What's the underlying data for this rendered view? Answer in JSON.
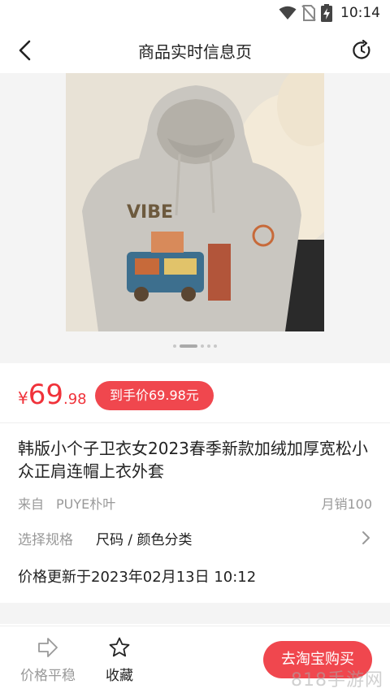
{
  "status_bar": {
    "time": "10:14",
    "icons": [
      "wifi-icon",
      "no-sim-icon",
      "battery-charging-icon"
    ]
  },
  "nav": {
    "title": "商品实时信息页",
    "back_icon": "back-arrow-icon",
    "refresh_icon": "refresh-icon"
  },
  "gallery": {
    "image": "grey hooded sweatshirt with cartoon truck embroidery",
    "image_count": 5,
    "active_index": 1
  },
  "price": {
    "symbol": "¥",
    "integer": "69",
    "decimal": ".98",
    "final_badge": "到手价69.98元"
  },
  "product": {
    "title": "韩版小个子卫衣女2023春季新款加绒加厚宽松小众正肩连帽上衣外套",
    "source_label": "来自",
    "shop": "PUYE朴叶",
    "sales": "月销100"
  },
  "spec": {
    "label": "选择规格",
    "value": "尺码 / 颜色分类",
    "arrow_icon": "chevron-right-icon"
  },
  "updated": "价格更新于2023年02月13日 10:12",
  "bottom": {
    "price_stable_label": "价格平稳",
    "favorite_label": "收藏",
    "buy_label": "去淘宝购买"
  },
  "watermark": "818手游网",
  "colors": {
    "accent": "#f0474e",
    "price": "#f0323a",
    "muted_text": "#999999",
    "background_grey": "#f4f4f4"
  }
}
